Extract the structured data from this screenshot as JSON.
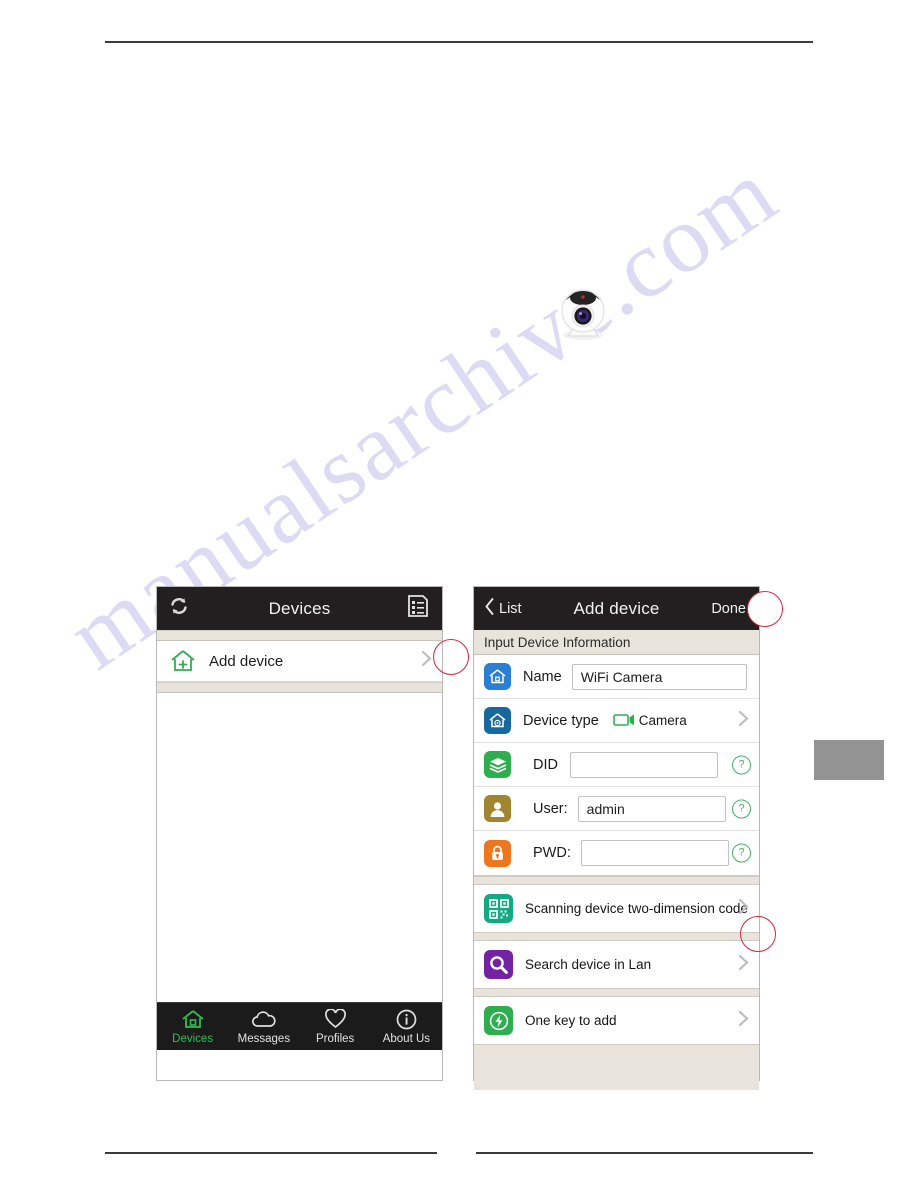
{
  "document": {
    "watermark_text": "manualsarchive.com"
  },
  "product_photo": {
    "name": "wifi-camera-photo"
  },
  "left_phone": {
    "navbar": {
      "refresh_icon": "refresh-icon",
      "title": "Devices",
      "list_icon": "list-icon"
    },
    "list": {
      "add_device": {
        "icon": "house-plus-icon",
        "label": "Add device",
        "chevron": "chevron-right-icon"
      }
    },
    "tabbar": [
      {
        "icon": "home-icon",
        "label": "Devices",
        "active": true
      },
      {
        "icon": "cloud-icon",
        "label": "Messages",
        "active": false
      },
      {
        "icon": "heart-icon",
        "label": "Profiles",
        "active": false
      },
      {
        "icon": "info-icon",
        "label": "About Us",
        "active": false
      }
    ]
  },
  "right_phone": {
    "navbar": {
      "back_icon": "chevron-left-icon",
      "back_label": "List",
      "title": "Add device",
      "done_label": "Done"
    },
    "section_title": "Input Device Information",
    "fields": [
      {
        "icon": "house-blue-icon",
        "icon_color": "#2a7fd4",
        "label": "Name",
        "value": "WiFi Camera",
        "placeholder": "",
        "has_help": false,
        "has_chevron": false
      },
      {
        "icon": "house-gear-icon",
        "icon_color": "#16699c",
        "label": "Device type",
        "value": "Camera",
        "value_icon": "camera-icon",
        "has_help": false,
        "has_chevron": true
      },
      {
        "icon": "layers-icon",
        "icon_color": "#2fae4f",
        "label": "DID",
        "value": "",
        "placeholder": "",
        "has_help": true,
        "has_chevron": false
      },
      {
        "icon": "user-icon",
        "icon_color": "#a1862f",
        "label": "User:",
        "value": "admin",
        "placeholder": "",
        "has_help": true,
        "has_chevron": false
      },
      {
        "icon": "lock-icon",
        "icon_color": "#f0761e",
        "label": "PWD:",
        "value": "",
        "placeholder": "",
        "has_help": true,
        "has_chevron": false
      }
    ],
    "actions": [
      {
        "icon": "qr-code-icon",
        "icon_color": "#12a983",
        "label": "Scanning device two-dimension code",
        "chevron": "chevron-right-icon"
      },
      {
        "icon": "magnifier-icon",
        "icon_color": "#7322a3",
        "label": "Search device in Lan",
        "chevron": "chevron-right-icon"
      },
      {
        "icon": "lightning-icon",
        "icon_color": "#2fae4f",
        "label": "One key to add",
        "chevron": "chevron-right-icon"
      }
    ]
  },
  "annotations": [
    {
      "name": "annotation-circle-add-device"
    },
    {
      "name": "annotation-circle-done"
    },
    {
      "name": "annotation-circle-scan-row"
    }
  ],
  "colors": {
    "navbar_bg": "#231f20",
    "accent_green": "#2fbe4f",
    "annotation_red": "#d2283c",
    "beige": "#e8e4dc",
    "page_tab_gray": "#939393"
  }
}
